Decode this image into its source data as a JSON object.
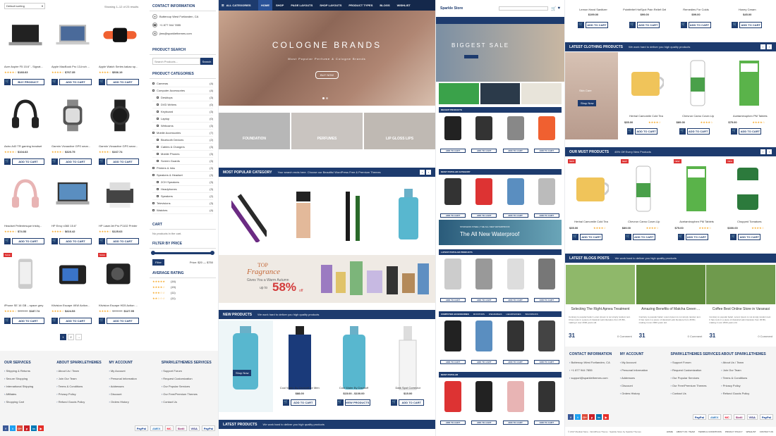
{
  "p1": {
    "sorting": "Default sorting",
    "results": "Showing 1–12 of 23 results",
    "products": [
      {
        "name": "Acer Aspire F5 15.6\" - Signat...",
        "price": "$183.63",
        "btn": "BUY PRODUCT",
        "sale": false
      },
      {
        "name": "Apple MacBook Pro 13-Inch ...",
        "price": "$767.35",
        "btn": "ADD TO CART",
        "sale": false
      },
      {
        "name": "Apple Watch Series kakao sp...",
        "price": "$536.19",
        "btn": "ADD TO CART",
        "sale": false
      },
      {
        "name": "Astro A40 TR gaming headset",
        "price": "$104.63",
        "btn": "ADD TO CART",
        "sale": false
      },
      {
        "name": "Garmin Vivoactive GPS smar...",
        "price": "$320.75",
        "btn": "ADD TO CART",
        "sale": false
      },
      {
        "name": "Garmin Vivoactive GPS smar...",
        "price": "$167.74",
        "btn": "ADD TO CART",
        "sale": false
      },
      {
        "name": "Headset Pellentesque tristiq...",
        "price": "$74.53",
        "btn": "ADD TO CART",
        "sale": false
      },
      {
        "name": "HP Envy x360 15.6\"",
        "price": "$616.42",
        "btn": "ADD TO CART",
        "sale": false
      },
      {
        "name": "HP LaserJet Pro P1102 Printer",
        "price": "$125.63",
        "btn": "ADD TO CART",
        "sale": false
      },
      {
        "name": "iPhone SE 16 GB – space grey",
        "price": "$187.74",
        "old": "$220.00",
        "btn": "ADD TO CART",
        "sale": true
      },
      {
        "name": "Kitvision Escape 4KW Action...",
        "price": "$424.53",
        "btn": "ADD TO CART",
        "sale": false
      },
      {
        "name": "Kitvision Escape HD5 Action ...",
        "price": "$127.95",
        "old": "$200.00",
        "btn": "ADD TO CART",
        "sale": true
      }
    ],
    "sale_label": "SALE",
    "pages": [
      "1",
      "2",
      "→"
    ],
    "contact_title": "CONTACT INFORMATION",
    "contact": [
      "Buttercup West Fortlanden, CA",
      "+1 877 944 7855",
      "jims@sparklethemes.com"
    ],
    "search_title": "PRODUCT SEARCH",
    "search_placeholder": "Search Products...",
    "search_btn": "Search",
    "cat_title": "PRODUCT CATEGORIES",
    "categories": [
      {
        "n": "Cameras",
        "c": "(4)",
        "sub": false
      },
      {
        "n": "Computer Accessories",
        "c": "(4)",
        "sub": false
      },
      {
        "n": "Desktops",
        "c": "(3)",
        "sub": true
      },
      {
        "n": "DVD Writers",
        "c": "(0)",
        "sub": true
      },
      {
        "n": "Keyboard",
        "c": "(3)",
        "sub": true
      },
      {
        "n": "Laptop",
        "c": "(0)",
        "sub": true
      },
      {
        "n": "Webcams",
        "c": "(3)",
        "sub": true
      },
      {
        "n": "Mobile Accessories",
        "c": "(7)",
        "sub": false
      },
      {
        "n": "Bluetooth Devices",
        "c": "(2)",
        "sub": true
      },
      {
        "n": "Cables & Chargers",
        "c": "(3)",
        "sub": true
      },
      {
        "n": "Mobile Phones",
        "c": "(3)",
        "sub": true
      },
      {
        "n": "Screen Guards",
        "c": "(3)",
        "sub": true
      },
      {
        "n": "Printers & Inks",
        "c": "(3)",
        "sub": false
      },
      {
        "n": "Speakers & Headset",
        "c": "(3)",
        "sub": false
      },
      {
        "n": "2CH Speakers",
        "c": "(3)",
        "sub": true
      },
      {
        "n": "Headphones",
        "c": "(3)",
        "sub": true
      },
      {
        "n": "Speakers",
        "c": "(2)",
        "sub": true
      },
      {
        "n": "Televisions",
        "c": "(3)",
        "sub": false
      },
      {
        "n": "Watches",
        "c": "(4)",
        "sub": false
      }
    ],
    "cart_title": "CART",
    "cart_text": "No products in the cart.",
    "filter_title": "FILTER BY PRICE",
    "filter_btn": "Filter",
    "filter_text": "Price: $20 — $750",
    "rating_title": "AVERAGE RATING",
    "ratings": [
      {
        "s": "★★★★★",
        "c": "(16)"
      },
      {
        "s": "★★★★☆",
        "c": "(15)"
      },
      {
        "s": "★★★☆☆",
        "c": "(11)"
      },
      {
        "s": "★★☆☆☆",
        "c": "(11)"
      }
    ],
    "footer": [
      {
        "title": "OUR SERVICES",
        "items": [
          "Shipping & Returns",
          "Secure Shopping",
          "International Shipping",
          "Affiliates",
          "Shopping Cart"
        ]
      },
      {
        "title": "ABOUT SPARKLETHEMES",
        "items": [
          "About Us / Team",
          "Join Our Team",
          "Terms & Conditions",
          "Privacy Policy",
          "Refund Goods Policy"
        ]
      },
      {
        "title": "MY ACCOUNT",
        "items": [
          "My Account",
          "Personal Information",
          "Addresses",
          "Discount",
          "Orders History"
        ]
      },
      {
        "title": "SPARKLETHEMES SERVICES",
        "items": [
          "Support Forum",
          "Request Customization",
          "Our Popular Services",
          "Our Free/Premium Themes",
          "Contact Us"
        ]
      }
    ]
  },
  "p2": {
    "nav": [
      "ALL CATEGORIES",
      "HOME",
      "SHOP",
      "PAGE LAYOUTS",
      "SHOP LAYOUTS",
      "PRODUCT TYPES",
      "BLOGS",
      "WISHLIST"
    ],
    "hero_title": "COLOGNE BRANDS",
    "hero_sub": "Most Popular Perfume & Cologne Brands",
    "hero_btn": "BUY NOW",
    "cats": [
      "FOUNDATION",
      "PERFUMES",
      "LIP GLOSS LIPS"
    ],
    "popular_title": "MOST POPULAR CATEGORY",
    "popular_sub": "Your search ends here. Choose our Beautiful WordPress Free & Premium Themes",
    "promo_top": "TOP",
    "promo_brand": "Fragrance",
    "promo_text": "Gives You a Warm Autumn",
    "promo_upto": "up to",
    "promo_pct": "58%",
    "promo_off": "off",
    "new_title": "NEW PRODUCTS",
    "new_sub": "We work hard to deliver you high quality products",
    "new_products": [
      {
        "name": "",
        "price": "",
        "btn": "Shop Now"
      },
      {
        "name": "Cool Water By Davidoff for Men",
        "price": "$88.00",
        "btn": "ADD TO CART"
      },
      {
        "name": "Cool Water By Davidoff",
        "price": "$15.00 - $100.00",
        "btn": "VIEW PRODUCTS"
      },
      {
        "name": "Dark Spot Corrector",
        "price": "$15.00",
        "btn": "ADD TO CART"
      }
    ],
    "latest_title": "LATEST PRODUCTS",
    "latest_sub": "We work hard to deliver you high quality products"
  },
  "p3": {
    "logo": "Sparkle Store",
    "hero_title": "BIGGEST SALE",
    "banner_text": "The All New Waterproof",
    "banner_small": "STAINLESS STEEL | THE ALL NEW WATERPROOF",
    "sec1": "RECENT PRODUCTS",
    "sec2": "MOST POPULAR CATEGORY",
    "sec3": "LATEST POPULAR PRODUCTS",
    "sec4": "COMPUTER ACCESSORIES",
    "sec5": "MOST POPULAR",
    "tabs": [
      "MONITORS",
      "WEARABLES",
      "HEADPHONES",
      "BACKPACKS"
    ],
    "btn": "ADD TO CART"
  },
  "p4": {
    "top_products": [
      {
        "name": "Lemon Hand Sanitizer",
        "price": "$199.00"
      },
      {
        "name": "Pointfeltef HotSpot Pain Relief Gel",
        "price": "$99.00"
      },
      {
        "name": "Remedies For Colds",
        "price": "$99.00"
      },
      {
        "name": "Honey Cream",
        "price": "$45.00"
      }
    ],
    "clothing_title": "LATEST CLOTHING PRODUCTS",
    "clothing_sub": "We work hard to deliver you high quality products",
    "skin_text": "Skin Care",
    "shop_now": "Shop Now",
    "clothing_products": [
      {
        "name": "Herbal Camomile Cold Tea",
        "price": "$35.00"
      },
      {
        "name": "Chevron Camo Cover-Up",
        "price": "$89.00"
      },
      {
        "name": "Acetaminophen PM Tablets",
        "price": "$75.00"
      }
    ],
    "must_title": "OUR MUST PRODUCTS",
    "must_sub": "45% Off Every New Products",
    "must_products": [
      {
        "name": "Herbal Camomile Cold Tea",
        "price": "$35.00"
      },
      {
        "name": "Chevron Camo Cover-Up",
        "price": "$89.00"
      },
      {
        "name": "Acetaminophen PM Tablets",
        "price": "$75.00"
      },
      {
        "name": "Chopped Tomatoes",
        "price": "$300.00"
      }
    ],
    "new_label": "NEW",
    "btn": "ADD TO CART",
    "blog_title": "LATEST BLOGS POSTS",
    "blog_sub": "We work hard to deliver you high quality products",
    "blogs": [
      {
        "title": "Selecting The Right Apnea Treatment",
        "day": "31",
        "comment": "0 Comment"
      },
      {
        "title": "Amazing Benefits of Matcha Green ...",
        "day": "31",
        "comment": "0 Comment"
      },
      {
        "title": "Coffee Best Online Store in Varanasi",
        "day": "31",
        "comment": "0 Comment"
      }
    ],
    "blog_text": "Contrary to popular belief, Lorem Ipsum is not simply random text. It has roots in a piece of classical Latin literature from 45 BC, making it over 2000 years old.",
    "footer": [
      {
        "title": "CONTACT INFORMATION",
        "items": [
          "Buttercup West Fortlanden, CA",
          "+1 877 944 7855",
          "support@sparklethemes.com"
        ]
      },
      {
        "title": "MY ACCOUNT",
        "items": [
          "My Account",
          "Personal Information",
          "Addresses",
          "Discount",
          "Orders History"
        ]
      },
      {
        "title": "SPARKLETHEMES SERVICES",
        "items": [
          "Support Forum",
          "Request Customization",
          "Our Popular Services",
          "Our Free/Premium Themes",
          "Contact Us"
        ]
      },
      {
        "title": "ABOUT SPARKLETHEMES",
        "items": [
          "About Us / Team",
          "Join Our Team",
          "Terms & Conditions",
          "Privacy Policy",
          "Refund Goods Policy"
        ]
      }
    ],
    "copyright": "© 2017 Medical Store - WordPress Theme : Sparkle Store by Sparkle Themes",
    "bottom_links": [
      "HOME",
      "ABOUT US / TEAM",
      "TERMS & CONDITIONS",
      "PRIVACY POLICY",
      "WISHLIST",
      "CONTACT US"
    ]
  },
  "payments": [
    "PayPal",
    "AMEX",
    "MC",
    "Skrill",
    "VISA",
    "PayPal"
  ],
  "social": [
    {
      "t": "f",
      "c": "#3b5998"
    },
    {
      "t": "t",
      "c": "#1da1f2"
    },
    {
      "t": "G+",
      "c": "#dd4b39"
    },
    {
      "t": "p",
      "c": "#cb2027"
    },
    {
      "t": "in",
      "c": "#0077b5"
    },
    {
      "t": "▶",
      "c": "#e52d27"
    }
  ]
}
